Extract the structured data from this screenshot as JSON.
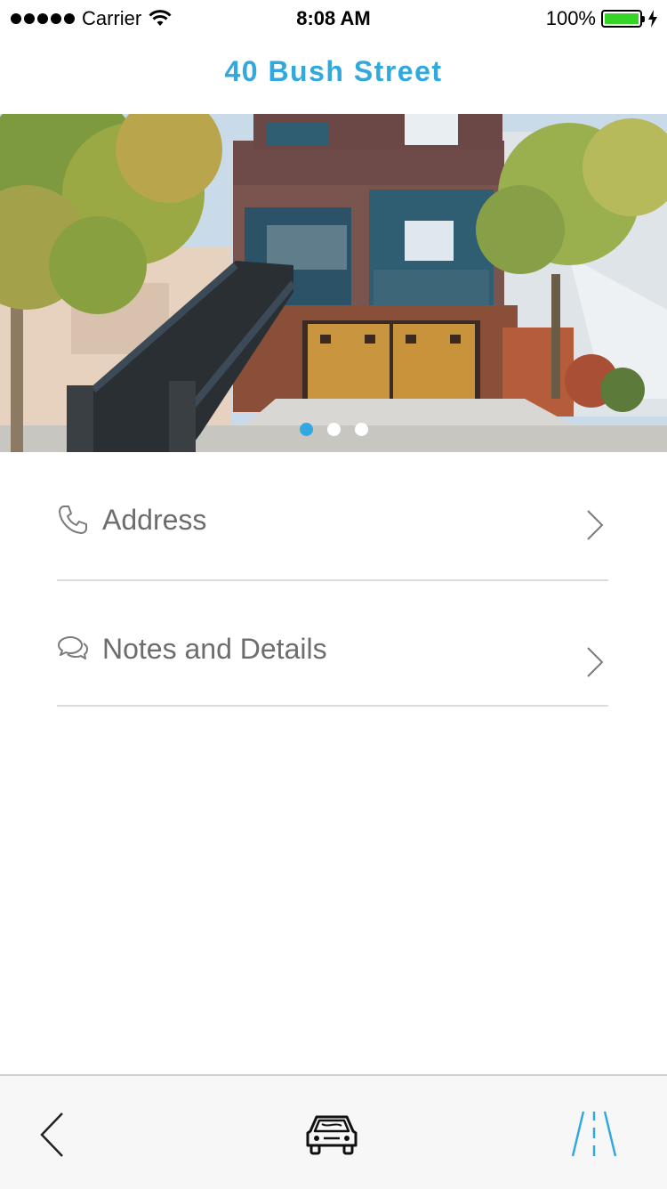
{
  "status_bar": {
    "carrier": "Carrier",
    "time": "8:08 AM",
    "battery": "100%",
    "battery_level": 1.0,
    "battery_color": "#35d427"
  },
  "header": {
    "title": "40 Bush Street",
    "title_color": "#32a9de"
  },
  "gallery": {
    "page_count": 3,
    "current_page": 1,
    "accent": "#32a9de"
  },
  "list": {
    "items": [
      {
        "label": "Address",
        "icon": "phone-icon"
      },
      {
        "label": "Notes and Details",
        "icon": "chat-bubbles-icon"
      }
    ]
  },
  "tab_bar": {
    "items": [
      {
        "icon": "back-chevron-icon"
      },
      {
        "icon": "car-icon"
      },
      {
        "icon": "road-icon",
        "color": "#32a9de"
      }
    ]
  }
}
